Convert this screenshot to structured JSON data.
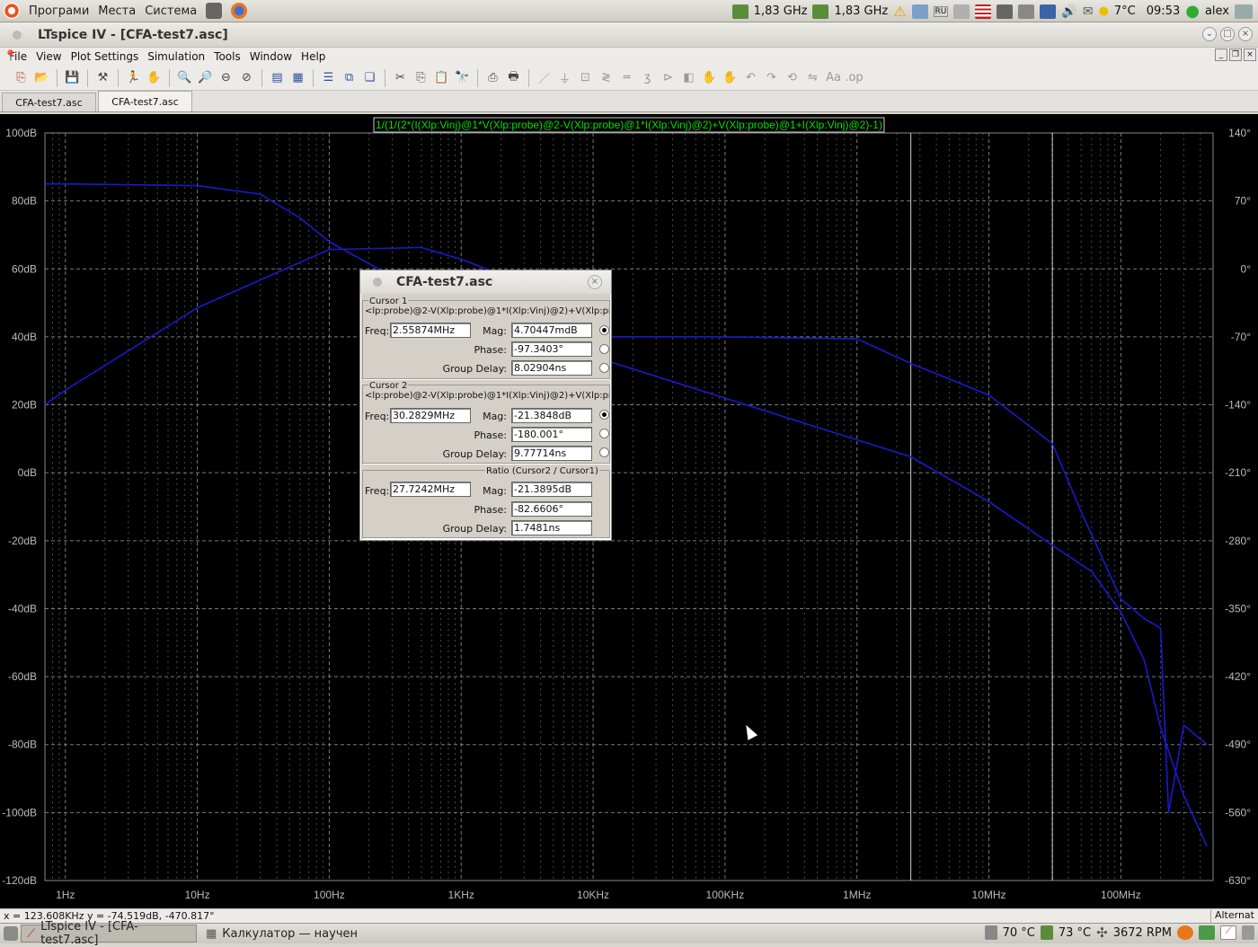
{
  "panel": {
    "menu": [
      "Програми",
      "Места",
      "Система"
    ],
    "cpu1": "1,83 GHz",
    "cpu2": "1,83 GHz",
    "kbd": "RU",
    "weather": "7°C",
    "time": "09:53",
    "user": "alex"
  },
  "window": {
    "title": "LTspice IV - [CFA-test7.asc]"
  },
  "menubar": [
    "File",
    "View",
    "Plot Settings",
    "Simulation",
    "Tools",
    "Window",
    "Help"
  ],
  "tabs": [
    {
      "label": "CFA-test7.asc",
      "active": false
    },
    {
      "label": "CFA-test7.asc",
      "active": true
    }
  ],
  "plot": {
    "expression": "1/(1/(2*(I(Xlp:Vinj)@1*V(Xlp:probe)@2-V(Xlp:probe)@1*I(Xlp:Vinj)@2)+V(Xlp:probe)@1+I(Xlp:Vinj)@2)-1)",
    "left_ticks": [
      "100dB",
      "80dB",
      "60dB",
      "40dB",
      "20dB",
      "0dB",
      "-20dB",
      "-40dB",
      "-60dB",
      "-80dB",
      "-100dB",
      "-120dB"
    ],
    "right_ticks": [
      "140°",
      "70°",
      "0°",
      "-70°",
      "-140°",
      "-210°",
      "-280°",
      "-350°",
      "-420°",
      "-490°",
      "-560°",
      "-630°"
    ],
    "x_ticks": [
      "1Hz",
      "10Hz",
      "100Hz",
      "1KHz",
      "10KHz",
      "100KHz",
      "1MHz",
      "10MHz",
      "100MHz"
    ],
    "trace_color": "#1a1acc",
    "grid_color": "#888888",
    "expr_color": "#00e000"
  },
  "chart_data": {
    "type": "line",
    "title": "",
    "xscale": "log",
    "xlabel": "",
    "ylabel": "",
    "xlim_hz": [
      0.7,
      500000000
    ],
    "ylim_db": [
      -120,
      100
    ],
    "ylim_deg": [
      -630,
      140
    ],
    "cursors_hz": [
      2558740,
      30282900
    ],
    "series": [
      {
        "axis": "left",
        "x": [
          0.7,
          1,
          10,
          30,
          60,
          100,
          1000,
          2558740,
          10000000,
          30282900,
          60000000,
          100000000,
          150000000,
          200000000,
          300000000,
          450000000
        ],
        "y": [
          85,
          85,
          84.5,
          82,
          75,
          68,
          46.5,
          4.7,
          -8.5,
          -21.38,
          -29,
          -41,
          -55,
          -75,
          -95,
          -110
        ]
      },
      {
        "axis": "right",
        "x": [
          0.7,
          1,
          10,
          100,
          500,
          1000,
          3000,
          10000,
          100000,
          1000000,
          2558740,
          10000000,
          30282900,
          50000000,
          100000000,
          150000000,
          200000000,
          230000000,
          300000000,
          450000000
        ],
        "y": [
          -140,
          -125,
          -40,
          20,
          22,
          10,
          -15,
          -70,
          -70,
          -72,
          -97.34,
          -130,
          -180,
          -250,
          -340,
          -360,
          -370,
          -560,
          -470,
          -490
        ]
      }
    ]
  },
  "dialog": {
    "title": "CFA-test7.asc",
    "cursor1": {
      "label": "Cursor 1",
      "expr": "<lp:probe)@2-V(Xlp:probe)@1*I(Xlp:Vinj)@2)+V(Xlp:pr",
      "freq": "2.55874MHz",
      "mag": "4.70447mdB",
      "phase": "-97.3403°",
      "gd": "8.02904ns"
    },
    "cursor2": {
      "label": "Cursor 2",
      "expr": "<lp:probe)@2-V(Xlp:probe)@1*I(Xlp:Vinj)@2)+V(Xlp:pr",
      "freq": "30.2829MHz",
      "mag": "-21.3848dB",
      "phase": "-180.001°",
      "gd": "9.77714ns"
    },
    "ratio": {
      "label": "Ratio (Cursor2 / Cursor1)",
      "freq": "27.7242MHz",
      "mag": "-21.3895dB",
      "phase": "-82.6606°",
      "gd": "1.7481ns"
    },
    "labels": {
      "freq": "Freq:",
      "mag": "Mag:",
      "phase": "Phase:",
      "gd": "Group Delay:"
    }
  },
  "status": {
    "readout": "x = 123.608KHz     y = -74.519dB, -470.817°",
    "mode": "Alternat"
  },
  "taskbar": {
    "tasks": [
      "LTspice IV - [CFA-test7.asc]",
      "Калкулатор — научен"
    ],
    "temp1": "70 °C",
    "temp2": "73 °C",
    "fan": "3672 RPM"
  }
}
